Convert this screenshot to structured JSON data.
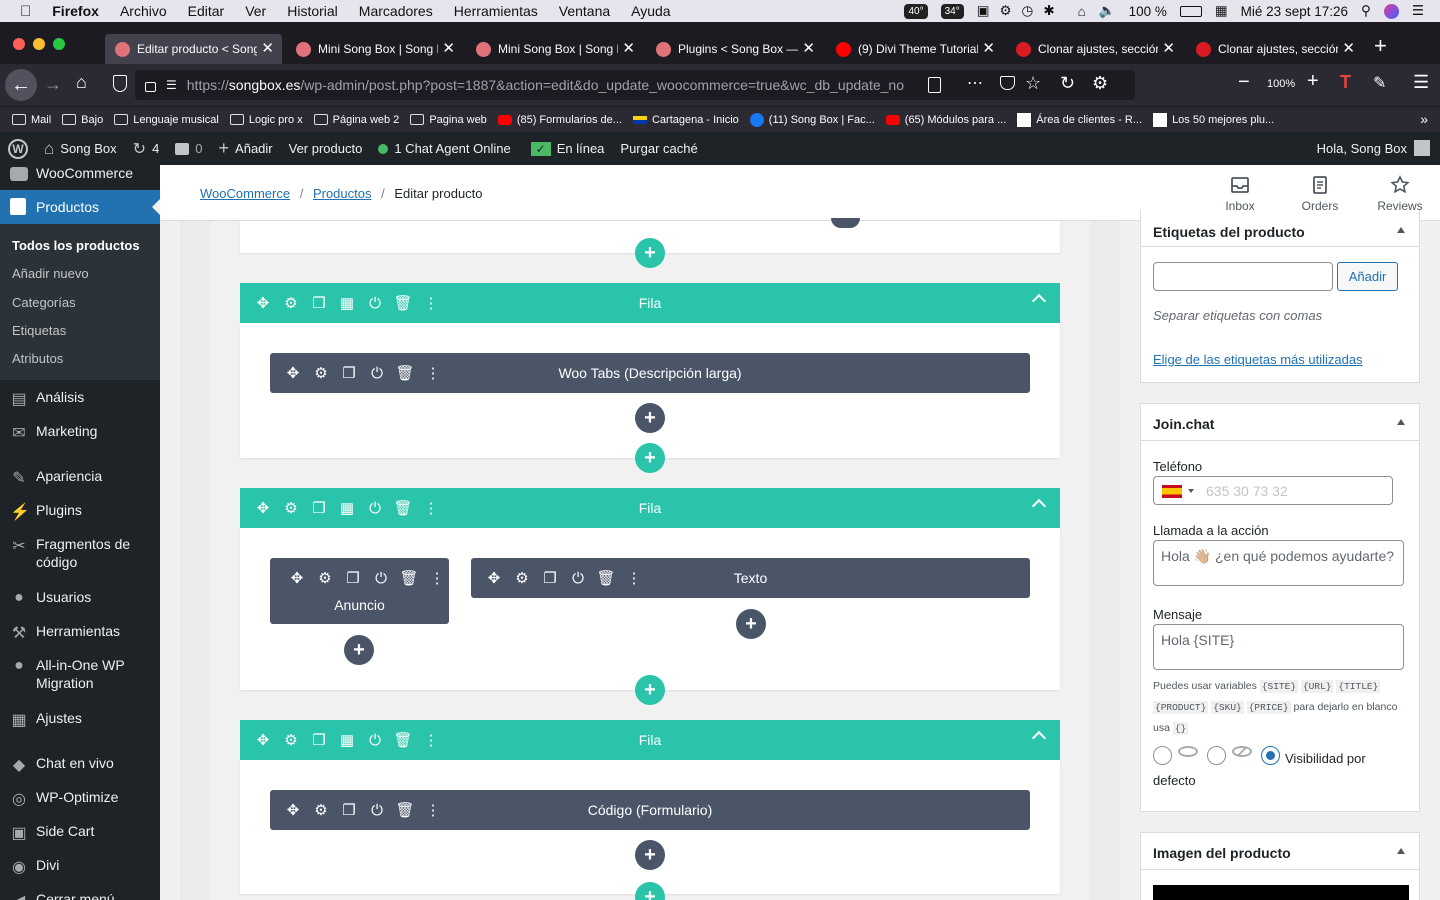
{
  "macbar": {
    "menus": [
      "Firefox",
      "Archivo",
      "Editar",
      "Ver",
      "Historial",
      "Marcadores",
      "Herramientas",
      "Ventana",
      "Ayuda"
    ],
    "temp1": "40°",
    "temp2": "34°",
    "battery": "100 %",
    "datetime": "Mié 23 sept  17:26"
  },
  "tabs": [
    {
      "title": "Editar producto < Song Box",
      "active": true,
      "fav": "#e0727a"
    },
    {
      "title": "Mini Song Box | Song Box",
      "fav": "#e0727a"
    },
    {
      "title": "Mini Song Box | Song Box",
      "fav": "#e0727a"
    },
    {
      "title": "Plugins < Song Box — WordPress",
      "fav": "#e0727a"
    },
    {
      "title": "(9) Divi Theme Tutorial",
      "fav": "#ff0000"
    },
    {
      "title": "Clonar ajustes, sección",
      "fav": "#d81b22"
    },
    {
      "title": "Clonar ajustes, sección",
      "fav": "#d81b22"
    }
  ],
  "nav": {
    "url_prefix": "https://",
    "url_host": "songbox.es",
    "url_path": "/wp-admin/post.php?post=1887&action=edit&do_update_woocommerce=true&wc_db_update_no",
    "zoom": "100%"
  },
  "bookmarks": [
    "Mail",
    "Bajo",
    "Lenguaje musical",
    "Logic pro x",
    "Página web 2",
    "Pagina web",
    "(85) Formularios de...",
    "Cartagena - Inicio",
    "(11) Song Box | Fac...",
    "(65) Módulos para ...",
    "Área de clientes - R...",
    "Los 50 mejores plu..."
  ],
  "wpbar": {
    "site": "Song Box",
    "updates": "4",
    "comments": "0",
    "add": "Añadir",
    "view": "Ver producto",
    "chat": "1 Chat Agent Online",
    "online": "En línea",
    "purge": "Purgar caché",
    "greeting": "Hola, Song Box"
  },
  "sidebar": {
    "woocommerce": "WooCommerce",
    "products": "Productos",
    "sub": [
      "Todos los productos",
      "Añadir nuevo",
      "Categorías",
      "Etiquetas",
      "Atributos"
    ],
    "items": [
      "Análisis",
      "Marketing",
      "Apariencia",
      "Plugins",
      "Fragmentos de código",
      "Usuarios",
      "Herramientas",
      "All-in-One WP Migration",
      "Ajustes",
      "Chat en vivo",
      "WP-Optimize",
      "Side Cart",
      "Divi",
      "Cerrar menú"
    ]
  },
  "header": {
    "crumb1": "WooCommerce",
    "crumb2": "Productos",
    "current": "Editar producto",
    "sep": "/",
    "inbox": "Inbox",
    "orders": "Orders",
    "reviews": "Reviews"
  },
  "builder": {
    "row_label": "Fila",
    "module1": "Woo Tabs (Descripción larga)",
    "module2": "Anuncio",
    "module3": "Texto",
    "module4": "Código (Formulario)",
    "plus": "+"
  },
  "tags": {
    "title": "Etiquetas del producto",
    "add": "Añadir",
    "hint": "Separar etiquetas con comas",
    "link": "Elige de las etiquetas más utilizadas"
  },
  "joinchat": {
    "title": "Join.chat",
    "phone_label": "Teléfono",
    "phone_placeholder": "635 30 73 32",
    "cta_label": "Llamada a la acción",
    "cta_value": "Hola 👋🏼 ¿en qué podemos ayudarte?",
    "msg_label": "Mensaje",
    "msg_value": "Hola {SITE}",
    "vars_text": "Puedes usar variables",
    "vars": [
      "{SITE}",
      "{URL}",
      "{TITLE}",
      "{PRODUCT}",
      "{SKU}",
      "{PRICE}"
    ],
    "blank_text": "para dejarlo en blanco usa",
    "blank_var": "{}",
    "visibility": "Visibilidad por defecto"
  },
  "image": {
    "title": "Imagen del producto"
  }
}
